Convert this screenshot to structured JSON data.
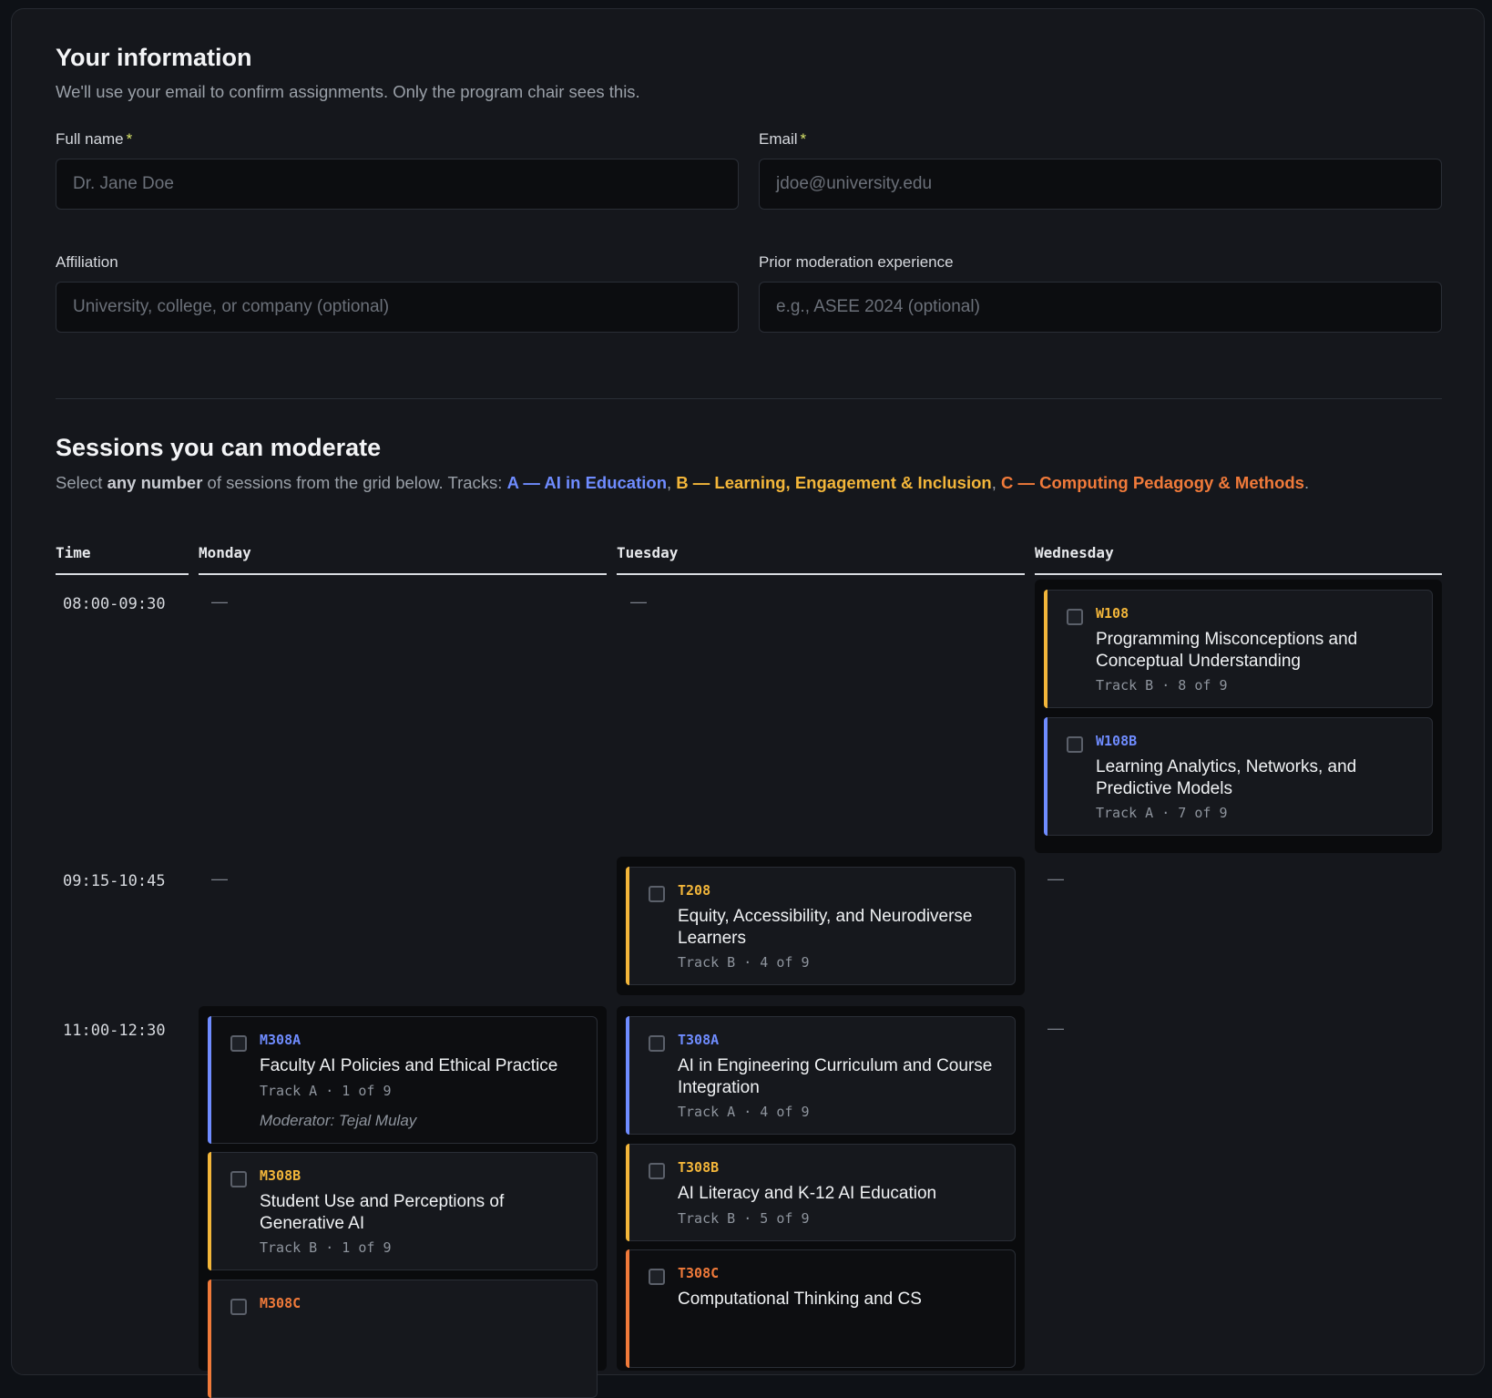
{
  "info": {
    "heading": "Your information",
    "subtitle": "We'll use your email to confirm assignments. Only the program chair sees this.",
    "fields": {
      "full_name": {
        "label": "Full name",
        "required_mark": "*",
        "placeholder": "Dr. Jane Doe"
      },
      "email": {
        "label": "Email",
        "required_mark": "*",
        "placeholder": "jdoe@university.edu"
      },
      "affiliation": {
        "label": "Affiliation",
        "placeholder": "University, college, or company (optional)"
      },
      "experience": {
        "label": "Prior moderation experience",
        "placeholder": "e.g., ASEE 2024 (optional)"
      }
    }
  },
  "sessions": {
    "heading": "Sessions you can moderate",
    "intro_1": "Select ",
    "intro_bold": "any number",
    "intro_2": " of sessions from the grid below. Tracks: ",
    "track_a": "A — AI in Education",
    "sep_1": ", ",
    "track_b": "B — Learning, Engagement & Inclusion",
    "sep_2": ", ",
    "track_c": "C — Computing Pedagogy & Methods",
    "end": ".",
    "columns": {
      "time": "Time",
      "mon": "Monday",
      "tue": "Tuesday",
      "wed": "Wednesday"
    },
    "empty": "—",
    "colors": {
      "A": "#6f8cff",
      "B": "#f3b63a",
      "C": "#f07a3a"
    },
    "times": [
      "08:00-09:30",
      "09:15-10:45",
      "11:00-12:30"
    ],
    "items": {
      "w108": {
        "code": "W108",
        "title": "Programming Misconceptions and Conceptual Understanding",
        "meta": "Track B · 8 of 9"
      },
      "w108b": {
        "code": "W108B",
        "title": "Learning Analytics, Networks, and Predictive Models",
        "meta": "Track A · 7 of 9"
      },
      "t208": {
        "code": "T208",
        "title": "Equity, Accessibility, and Neurodiverse Learners",
        "meta": "Track B · 4 of 9"
      },
      "m308a": {
        "code": "M308A",
        "title": "Faculty AI Policies and Ethical Practice",
        "meta": "Track A · 1 of 9",
        "moderator": "Moderator: Tejal Mulay"
      },
      "m308b": {
        "code": "M308B",
        "title": "Student Use and Perceptions of Generative AI",
        "meta": "Track B · 1 of 9"
      },
      "m308c": {
        "code": "M308C"
      },
      "t308a": {
        "code": "T308A",
        "title": "AI in Engineering Curriculum and Course Integration",
        "meta": "Track A · 4 of 9"
      },
      "t308b": {
        "code": "T308B",
        "title": "AI Literacy and K-12 AI Education",
        "meta": "Track B · 5 of 9"
      },
      "t308c": {
        "code": "T308C",
        "title": "Computational Thinking and CS"
      }
    }
  }
}
